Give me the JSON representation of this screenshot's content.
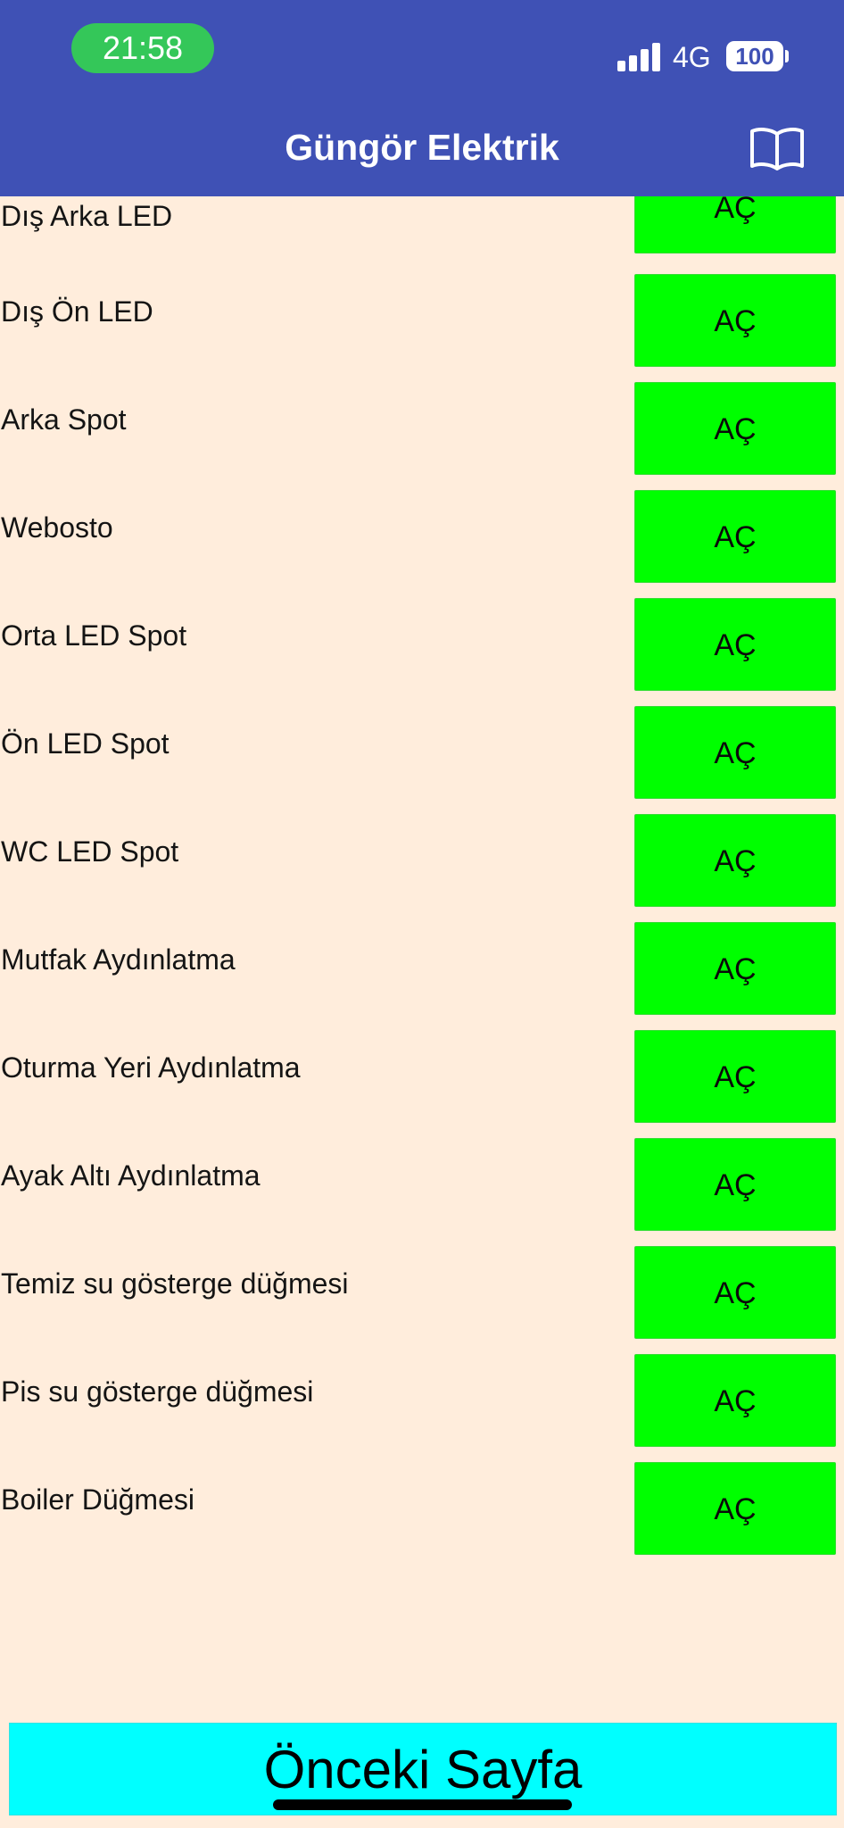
{
  "status_bar": {
    "time": "21:58",
    "network": "4G",
    "battery": "100"
  },
  "app_bar": {
    "title": "Güngör Elektrik",
    "right_icon": "book-open-icon"
  },
  "switches": [
    {
      "label": "Dış Arka LED",
      "button": "AÇ"
    },
    {
      "label": "Dış Ön LED",
      "button": "AÇ"
    },
    {
      "label": "Arka Spot",
      "button": "AÇ"
    },
    {
      "label": "Webosto",
      "button": "AÇ"
    },
    {
      "label": "Orta LED Spot",
      "button": "AÇ"
    },
    {
      "label": "Ön LED Spot",
      "button": "AÇ"
    },
    {
      "label": "WC LED Spot",
      "button": "AÇ"
    },
    {
      "label": "Mutfak Aydınlatma",
      "button": "AÇ"
    },
    {
      "label": "Oturma Yeri Aydınlatma",
      "button": "AÇ"
    },
    {
      "label": "Ayak Altı Aydınlatma",
      "button": "AÇ"
    },
    {
      "label": "Temiz su gösterge düğmesi",
      "button": "AÇ"
    },
    {
      "label": "Pis su gösterge düğmesi",
      "button": "AÇ"
    },
    {
      "label": "Boiler Düğmesi",
      "button": "AÇ"
    }
  ],
  "footer": {
    "previous_page_label": "Önceki Sayfa"
  },
  "colors": {
    "app_bar": "#3F51B5",
    "background": "#FFEDDC",
    "toggle_button": "#00FF00",
    "footer_button": "#00FFFF",
    "time_pill": "#34C759"
  }
}
